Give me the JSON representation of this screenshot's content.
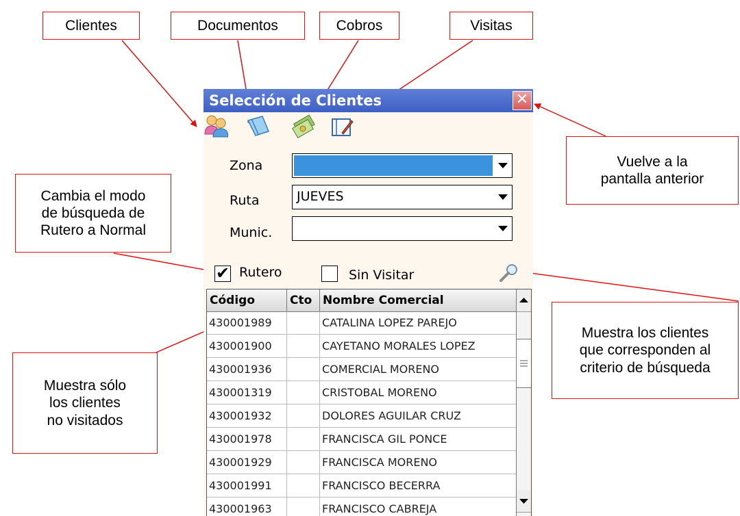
{
  "callouts": {
    "clientes": "Clientes",
    "documentos": "Documentos",
    "cobros": "Cobros",
    "visitas": "Visitas",
    "volver": "Vuelve a la\npantalla anterior",
    "modo": "Cambia el modo\nde búsqueda de\nRutero a Normal",
    "muestra_clientes": "Muestra los clientes\nque corresponden al\ncriterio de búsqueda",
    "sin_visitar": "Muestra sólo\nlos clientes\nno visitados"
  },
  "window": {
    "title": "Selección de Clientes",
    "close_glyph": "✕"
  },
  "toolbar": {
    "icons": [
      "clients-icon",
      "documents-icon",
      "payments-icon",
      "visits-icon"
    ]
  },
  "filters": {
    "zona_label": "Zona",
    "zona_value": "",
    "ruta_label": "Ruta",
    "ruta_value": "JUEVES",
    "munic_label": "Munic.",
    "munic_value": ""
  },
  "options": {
    "rutero_label": "Rutero",
    "rutero_checked": true,
    "sin_visitar_label": "Sin Visitar",
    "sin_visitar_checked": false
  },
  "table": {
    "columns": [
      "Código",
      "Cto",
      "Nombre Comercial"
    ],
    "rows": [
      [
        "430001989",
        "",
        "CATALINA LOPEZ PAREJO"
      ],
      [
        "430001900",
        "",
        "CAYETANO MORALES LOPEZ"
      ],
      [
        "430001936",
        "",
        "COMERCIAL MORENO"
      ],
      [
        "430001319",
        "",
        "CRISTOBAL MORENO"
      ],
      [
        "430001932",
        "",
        "DOLORES AGUILAR CRUZ"
      ],
      [
        "430001978",
        "",
        "FRANCISCA GIL PONCE"
      ],
      [
        "430001929",
        "",
        "FRANCISCA MORENO"
      ],
      [
        "430001991",
        "",
        "FRANCISCO BECERRA"
      ],
      [
        "430001963",
        "",
        "FRANCISCO CABREJA"
      ]
    ]
  },
  "colors": {
    "annotation": "#e01010",
    "titlebar": "#4a68cc",
    "zona_highlight": "#3a93dc"
  }
}
